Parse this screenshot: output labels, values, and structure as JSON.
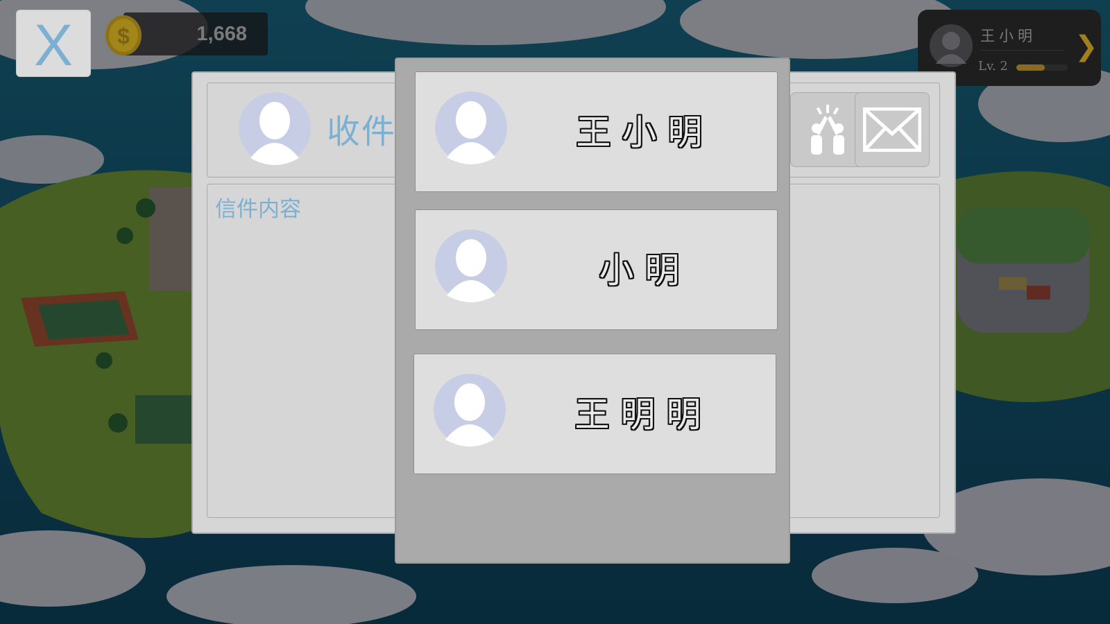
{
  "hud": {
    "close_label": "X",
    "coins": "1,668",
    "coin_icon": "coin-icon",
    "player": {
      "name": "王小明",
      "level": "Lv. 2",
      "xp_fraction": 0.55,
      "arrow_icon": "chevron-right-icon"
    }
  },
  "mail": {
    "recipient_label": "收件",
    "content_placeholder": "信件内容",
    "gift_icon": "high-five-icon",
    "send_icon": "envelope-icon"
  },
  "dropdown": {
    "contacts": [
      {
        "name": "王小明"
      },
      {
        "name": "小明"
      },
      {
        "name": "王明明"
      }
    ]
  },
  "colors": {
    "accent_blue": "#7cb0d2",
    "avatar_bg": "#c8cde6",
    "coin_gold": "#c9a21d",
    "xp_gold": "#8a6a1c"
  }
}
